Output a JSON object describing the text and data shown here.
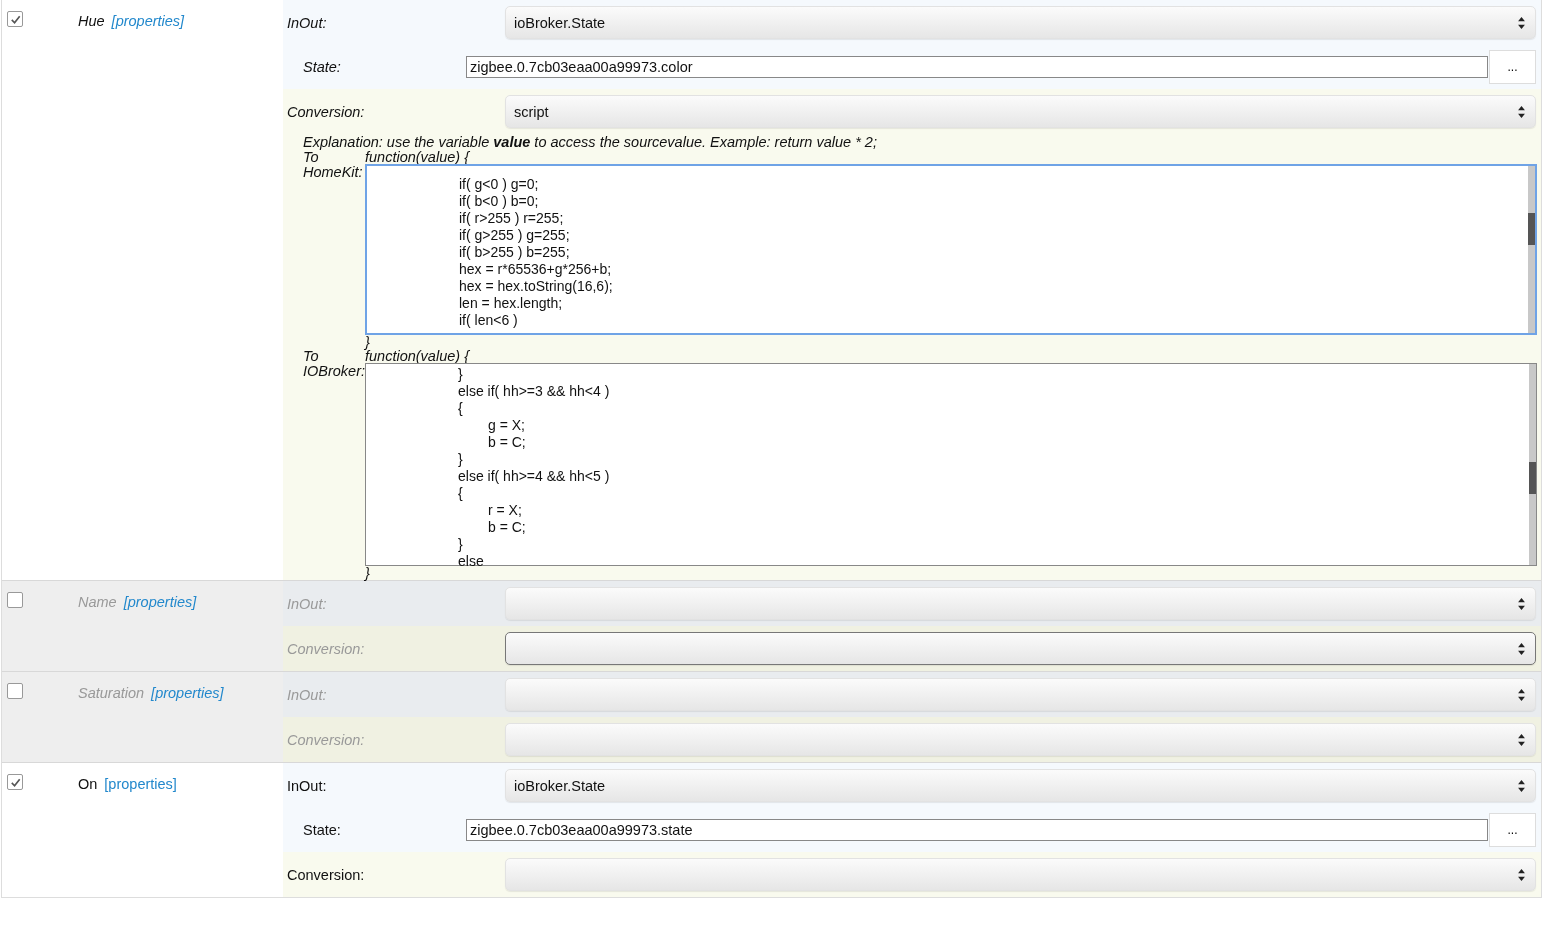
{
  "characteristics": [
    {
      "name": "Hue",
      "link": "[properties]",
      "kind": "optional",
      "checked": true,
      "fields": [
        {
          "kind": "inout",
          "label": "InOut:",
          "value": "ioBroker.State",
          "focused": false
        },
        {
          "kind": "state",
          "label": "State:",
          "value": "zigbee.0.7cb03eaa00a99973.color",
          "button": "..."
        },
        {
          "kind": "conversion",
          "label": "Conversion:",
          "value": "script",
          "focused": false
        },
        {
          "kind": "script",
          "explanation": "Explanation: use the variable **value** to access the sourcevalue. Example: return value * 2;",
          "scripts": [
            {
              "label": "To HomeKit:",
              "header": "function(value) {",
              "code": "\t\t\tif( g<0 ) g=0;\n\t\t\tif( b<0 ) b=0;\n\t\t\tif( r>255 ) r=255;\n\t\t\tif( g>255 ) g=255;\n\t\t\tif( b>255 ) b=255;\n\t\t\thex = r*65536+g*256+b;\n\t\t\thex = hex.toString(16,6);\n\t\t\tlen = hex.length;\n\t\t\tif( len<6 )",
              "footer": "}",
              "focused": true
            },
            {
              "label": "To IOBroker:",
              "header": "function(value) {",
              "code": "\t\t\t}\n\t\t\telse if( hh>=3 && hh<4 )\n\t\t\t{\n\t\t\t\tg = X;\n\t\t\t\tb = C;\n\t\t\t}\n\t\t\telse if( hh>=4 && hh<5 )\n\t\t\t{\n\t\t\t\tr = X;\n\t\t\t\tb = C;\n\t\t\t}\n\t\t\telse",
              "footer": "}",
              "focused": false
            }
          ]
        }
      ]
    },
    {
      "name": "Name",
      "link": "[properties]",
      "kind": "optional",
      "checked": false,
      "fields": [
        {
          "kind": "inout",
          "label": "InOut:",
          "focused": false
        },
        {
          "kind": "conversion",
          "label": "Conversion:",
          "focused": true
        }
      ]
    },
    {
      "name": "Saturation",
      "link": "[properties]",
      "kind": "optional",
      "checked": false,
      "fields": [
        {
          "kind": "inout",
          "label": "InOut:",
          "focused": false
        },
        {
          "kind": "conversion",
          "label": "Conversion:",
          "focused": false
        }
      ]
    },
    {
      "name": "On",
      "link": "[properties]",
      "kind": "required",
      "checked": true,
      "fields": [
        {
          "kind": "inout",
          "label": "InOut:",
          "value": "ioBroker.State",
          "focused": false
        },
        {
          "kind": "state",
          "label": "State:",
          "value": "zigbee.0.7cb03eaa00a99973.state",
          "button": "..."
        },
        {
          "kind": "conversion",
          "label": "Conversion:",
          "focused": false
        }
      ]
    }
  ]
}
